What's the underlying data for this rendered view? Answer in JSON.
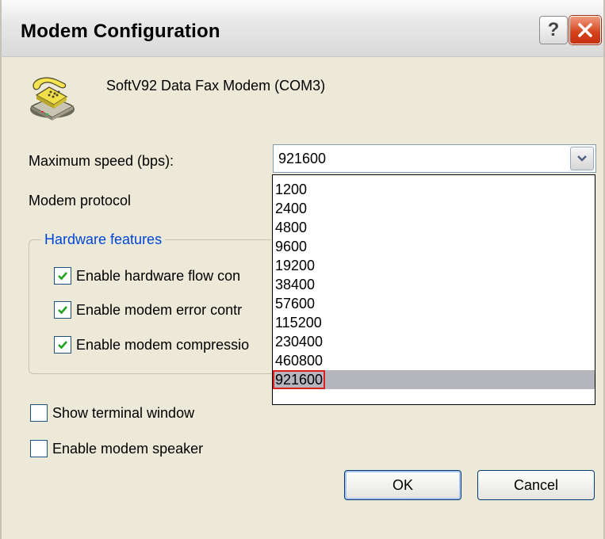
{
  "window": {
    "title": "Modem Configuration"
  },
  "titlebar": {
    "help_label": "?",
    "close_icon": "close-icon"
  },
  "device": {
    "icon": "telephone-modem-icon",
    "name": "SoftV92 Data Fax Modem (COM3)"
  },
  "speed": {
    "label": "Maximum speed (bps):",
    "value": "921600",
    "options": [
      "1200",
      "2400",
      "4800",
      "9600",
      "19200",
      "38400",
      "57600",
      "115200",
      "230400",
      "460800",
      "921600"
    ],
    "selected_index": 10
  },
  "protocol": {
    "label": "Modem protocol"
  },
  "hardware": {
    "title": "Hardware features",
    "items": [
      {
        "label": "Enable hardware flow con",
        "checked": true
      },
      {
        "label": "Enable modem error contr",
        "checked": true
      },
      {
        "label": "Enable modem compressio",
        "checked": true
      }
    ]
  },
  "options": {
    "terminal": {
      "label": "Show terminal window",
      "checked": false
    },
    "speaker": {
      "label": "Enable modem speaker",
      "checked": false
    }
  },
  "buttons": {
    "ok": "OK",
    "cancel": "Cancel"
  },
  "colors": {
    "accent": "#0046d5",
    "close": "#d4411b",
    "highlight": "#e0201c",
    "selected_bg": "#b5b5bd"
  }
}
